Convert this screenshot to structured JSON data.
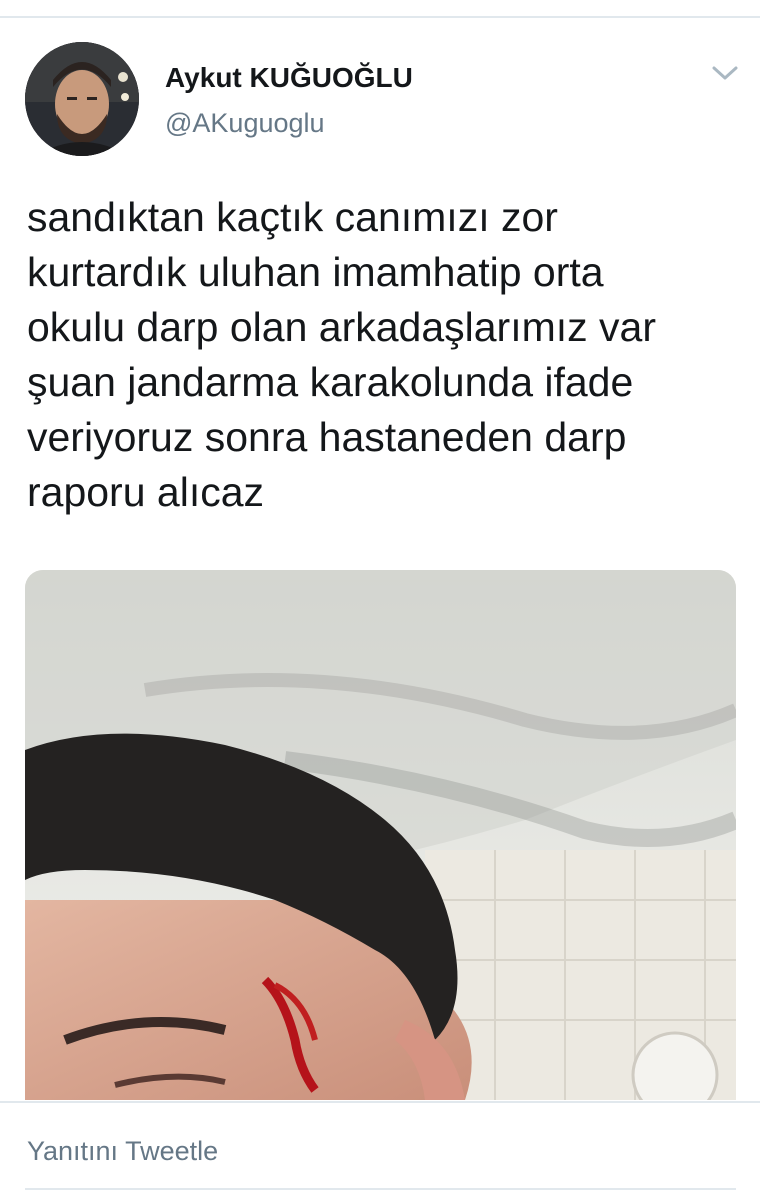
{
  "tweet": {
    "author": {
      "display_name": "Aykut KUĞUOĞLU",
      "handle": "@AKuguoglu"
    },
    "text": "sandıktan kaçtık canımızı zor\nkurtardık uluhan imamhatip orta\nokulu darp olan arkadaşlarımız var\nşuan jandarma karakolunda ifade\nveriyoruz sonra hastaneden darp\nraporu alıcaz",
    "menu_icon": "chevron-down-icon",
    "media_description_icon": "photo"
  },
  "footer": {
    "reply_label": "Yanıtını Tweetle"
  },
  "colors": {
    "text_primary": "#14171a",
    "text_secondary": "#657786",
    "divider": "#e1e8ed"
  }
}
